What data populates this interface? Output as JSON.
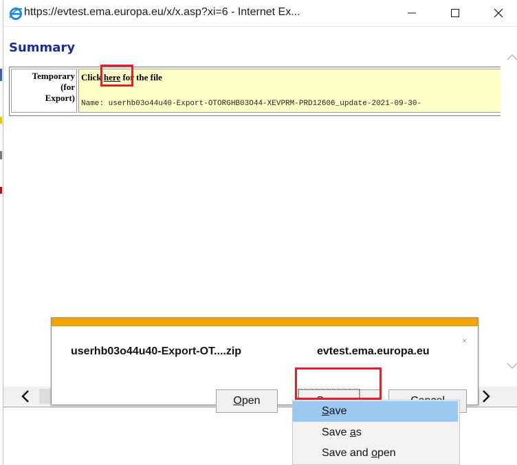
{
  "window": {
    "title": "https://evtest.ema.europa.eu/x/x.asp?xi=6 - Internet Ex...",
    "minimize_glyph": "—",
    "maximize_glyph": "☐",
    "close_glyph": "✕"
  },
  "page": {
    "heading": "Summary",
    "table": {
      "label_line1": "Temporary",
      "label_line2": "(for",
      "label_line3": "Export)",
      "click_prefix": "Click ",
      "link_text": "here",
      "click_suffix": " for the file",
      "file_name": "Name: userhb03o44u40-Export-OTORGHB03O44-XEVPRM-PRD12606_update-2021-09-30-"
    }
  },
  "download_bar": {
    "file_name": "userhb03o44u40-Export-OT....zip",
    "source": "evtest.ema.europa.eu",
    "close_glyph": "×",
    "buttons": {
      "open_mnemonic": "O",
      "open_rest": "pen",
      "save_mnemonic": "S",
      "save_rest": "ave",
      "cancel_mnemonic": "C",
      "cancel_rest": "ancel"
    }
  },
  "save_menu": {
    "items": [
      {
        "mnemonic": "S",
        "rest": "ave"
      },
      {
        "prefix": "Save ",
        "mnemonic": "a",
        "rest": "s"
      },
      {
        "prefix": "Save and ",
        "mnemonic": "o",
        "rest": "pen"
      }
    ],
    "selected_index": 0
  },
  "colors": {
    "accent_bar": "#f0a500",
    "heading_blue": "#1a2c9c",
    "highlight_red": "#e0202a",
    "menu_selected": "#99c9ef",
    "cell_yellow": "#fefec6"
  }
}
